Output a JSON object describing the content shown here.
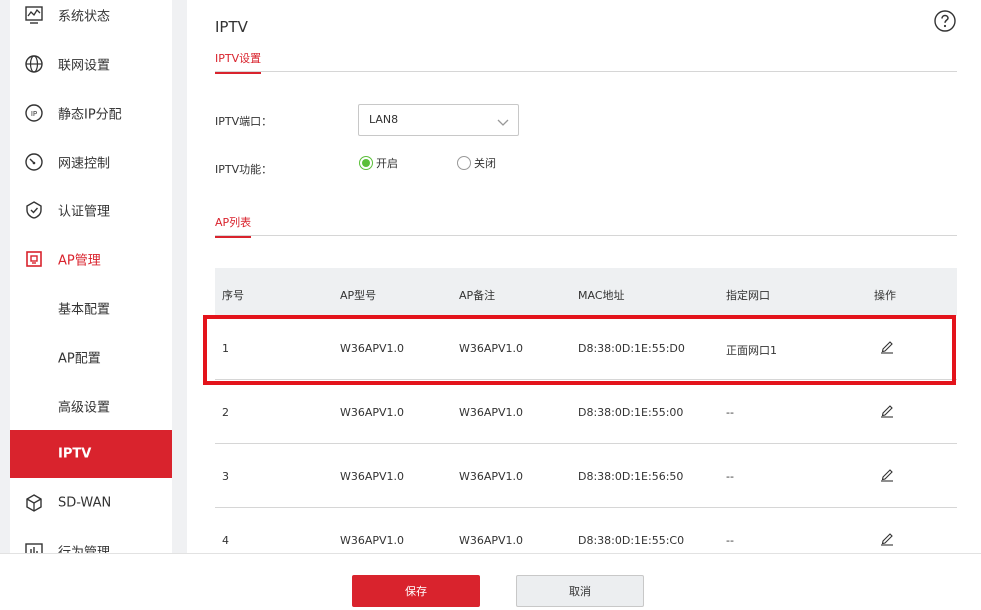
{
  "sidebar": {
    "items": [
      {
        "label": "系统状态",
        "icon": "monitor-icon"
      },
      {
        "label": "联网设置",
        "icon": "globe-icon"
      },
      {
        "label": "静态IP分配",
        "icon": "ip-icon"
      },
      {
        "label": "网速控制",
        "icon": "speedometer-icon"
      },
      {
        "label": "认证管理",
        "icon": "shield-check-icon"
      },
      {
        "label": "AP管理",
        "icon": "ap-icon"
      },
      {
        "label": "基本配置"
      },
      {
        "label": "AP配置"
      },
      {
        "label": "高级设置"
      },
      {
        "label": "IPTV"
      },
      {
        "label": "SD-WAN",
        "icon": "cube-icon"
      },
      {
        "label": "行为管理",
        "icon": "bar-chart-icon"
      }
    ]
  },
  "header": {
    "title": "IPTV",
    "help_icon": "question-circle-icon"
  },
  "iptv_settings": {
    "tab": "IPTV设置",
    "port_label": "IPTV端口：",
    "port_value": "LAN8",
    "function_label": "IPTV功能：",
    "option_on": "开启",
    "option_off": "关闭",
    "selected": "开启"
  },
  "ap_list": {
    "tab": "AP列表",
    "columns": [
      "序号",
      "AP型号",
      "AP备注",
      "MAC地址",
      "指定网口",
      "操作"
    ],
    "rows": [
      {
        "index": "1",
        "model": "W36APV1.0",
        "remark": "W36APV1.0",
        "mac": "D8:38:0D:1E:55:D0",
        "port": "正面网口1"
      },
      {
        "index": "2",
        "model": "W36APV1.0",
        "remark": "W36APV1.0",
        "mac": "D8:38:0D:1E:55:00",
        "port": "--"
      },
      {
        "index": "3",
        "model": "W36APV1.0",
        "remark": "W36APV1.0",
        "mac": "D8:38:0D:1E:56:50",
        "port": "--"
      },
      {
        "index": "4",
        "model": "W36APV1.0",
        "remark": "W36APV1.0",
        "mac": "D8:38:0D:1E:55:C0",
        "port": "--"
      }
    ]
  },
  "footer": {
    "save_label": "保存",
    "cancel_label": "取消"
  },
  "colors": {
    "accent": "#d9232d",
    "radio_on": "#5bbf3a",
    "highlight": "#e3131b"
  }
}
